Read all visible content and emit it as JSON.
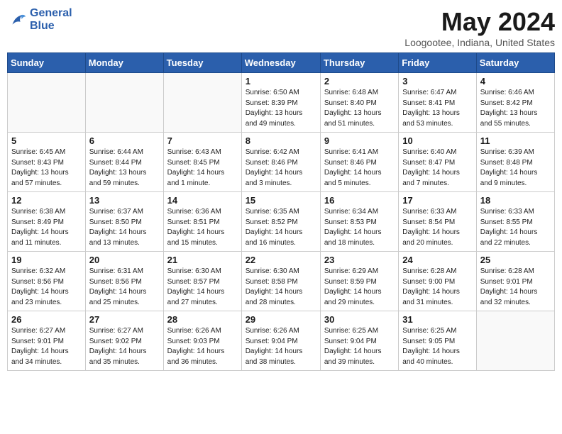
{
  "header": {
    "logo_line1": "General",
    "logo_line2": "Blue",
    "month_title": "May 2024",
    "location": "Loogootee, Indiana, United States"
  },
  "days_of_week": [
    "Sunday",
    "Monday",
    "Tuesday",
    "Wednesday",
    "Thursday",
    "Friday",
    "Saturday"
  ],
  "weeks": [
    [
      {
        "day": "",
        "info": ""
      },
      {
        "day": "",
        "info": ""
      },
      {
        "day": "",
        "info": ""
      },
      {
        "day": "1",
        "info": "Sunrise: 6:50 AM\nSunset: 8:39 PM\nDaylight: 13 hours\nand 49 minutes."
      },
      {
        "day": "2",
        "info": "Sunrise: 6:48 AM\nSunset: 8:40 PM\nDaylight: 13 hours\nand 51 minutes."
      },
      {
        "day": "3",
        "info": "Sunrise: 6:47 AM\nSunset: 8:41 PM\nDaylight: 13 hours\nand 53 minutes."
      },
      {
        "day": "4",
        "info": "Sunrise: 6:46 AM\nSunset: 8:42 PM\nDaylight: 13 hours\nand 55 minutes."
      }
    ],
    [
      {
        "day": "5",
        "info": "Sunrise: 6:45 AM\nSunset: 8:43 PM\nDaylight: 13 hours\nand 57 minutes."
      },
      {
        "day": "6",
        "info": "Sunrise: 6:44 AM\nSunset: 8:44 PM\nDaylight: 13 hours\nand 59 minutes."
      },
      {
        "day": "7",
        "info": "Sunrise: 6:43 AM\nSunset: 8:45 PM\nDaylight: 14 hours\nand 1 minute."
      },
      {
        "day": "8",
        "info": "Sunrise: 6:42 AM\nSunset: 8:46 PM\nDaylight: 14 hours\nand 3 minutes."
      },
      {
        "day": "9",
        "info": "Sunrise: 6:41 AM\nSunset: 8:46 PM\nDaylight: 14 hours\nand 5 minutes."
      },
      {
        "day": "10",
        "info": "Sunrise: 6:40 AM\nSunset: 8:47 PM\nDaylight: 14 hours\nand 7 minutes."
      },
      {
        "day": "11",
        "info": "Sunrise: 6:39 AM\nSunset: 8:48 PM\nDaylight: 14 hours\nand 9 minutes."
      }
    ],
    [
      {
        "day": "12",
        "info": "Sunrise: 6:38 AM\nSunset: 8:49 PM\nDaylight: 14 hours\nand 11 minutes."
      },
      {
        "day": "13",
        "info": "Sunrise: 6:37 AM\nSunset: 8:50 PM\nDaylight: 14 hours\nand 13 minutes."
      },
      {
        "day": "14",
        "info": "Sunrise: 6:36 AM\nSunset: 8:51 PM\nDaylight: 14 hours\nand 15 minutes."
      },
      {
        "day": "15",
        "info": "Sunrise: 6:35 AM\nSunset: 8:52 PM\nDaylight: 14 hours\nand 16 minutes."
      },
      {
        "day": "16",
        "info": "Sunrise: 6:34 AM\nSunset: 8:53 PM\nDaylight: 14 hours\nand 18 minutes."
      },
      {
        "day": "17",
        "info": "Sunrise: 6:33 AM\nSunset: 8:54 PM\nDaylight: 14 hours\nand 20 minutes."
      },
      {
        "day": "18",
        "info": "Sunrise: 6:33 AM\nSunset: 8:55 PM\nDaylight: 14 hours\nand 22 minutes."
      }
    ],
    [
      {
        "day": "19",
        "info": "Sunrise: 6:32 AM\nSunset: 8:56 PM\nDaylight: 14 hours\nand 23 minutes."
      },
      {
        "day": "20",
        "info": "Sunrise: 6:31 AM\nSunset: 8:56 PM\nDaylight: 14 hours\nand 25 minutes."
      },
      {
        "day": "21",
        "info": "Sunrise: 6:30 AM\nSunset: 8:57 PM\nDaylight: 14 hours\nand 27 minutes."
      },
      {
        "day": "22",
        "info": "Sunrise: 6:30 AM\nSunset: 8:58 PM\nDaylight: 14 hours\nand 28 minutes."
      },
      {
        "day": "23",
        "info": "Sunrise: 6:29 AM\nSunset: 8:59 PM\nDaylight: 14 hours\nand 29 minutes."
      },
      {
        "day": "24",
        "info": "Sunrise: 6:28 AM\nSunset: 9:00 PM\nDaylight: 14 hours\nand 31 minutes."
      },
      {
        "day": "25",
        "info": "Sunrise: 6:28 AM\nSunset: 9:01 PM\nDaylight: 14 hours\nand 32 minutes."
      }
    ],
    [
      {
        "day": "26",
        "info": "Sunrise: 6:27 AM\nSunset: 9:01 PM\nDaylight: 14 hours\nand 34 minutes."
      },
      {
        "day": "27",
        "info": "Sunrise: 6:27 AM\nSunset: 9:02 PM\nDaylight: 14 hours\nand 35 minutes."
      },
      {
        "day": "28",
        "info": "Sunrise: 6:26 AM\nSunset: 9:03 PM\nDaylight: 14 hours\nand 36 minutes."
      },
      {
        "day": "29",
        "info": "Sunrise: 6:26 AM\nSunset: 9:04 PM\nDaylight: 14 hours\nand 38 minutes."
      },
      {
        "day": "30",
        "info": "Sunrise: 6:25 AM\nSunset: 9:04 PM\nDaylight: 14 hours\nand 39 minutes."
      },
      {
        "day": "31",
        "info": "Sunrise: 6:25 AM\nSunset: 9:05 PM\nDaylight: 14 hours\nand 40 minutes."
      },
      {
        "day": "",
        "info": ""
      }
    ]
  ]
}
